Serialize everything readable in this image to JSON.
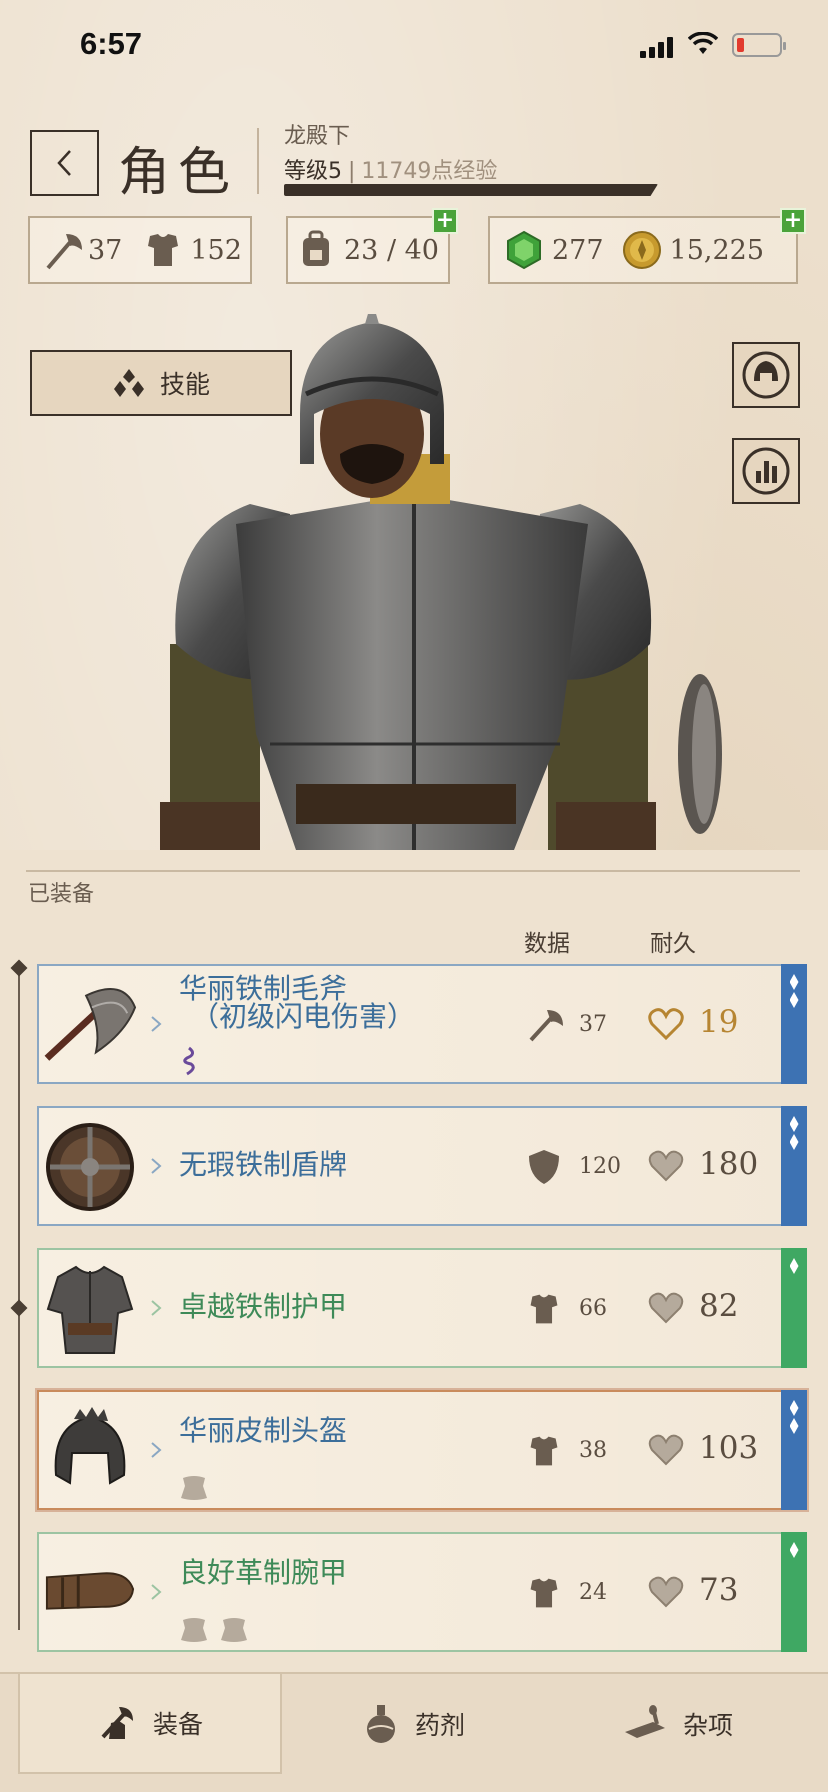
{
  "status_bar": {
    "time": "6:57"
  },
  "header": {
    "title": "角色",
    "player_name": "龙殿下",
    "level": "等级5",
    "separator": "|",
    "xp": "11749点经验"
  },
  "stats": {
    "attack": "37",
    "armor": "152",
    "carry": "23 / 40",
    "gems": "277",
    "gold": "15,225"
  },
  "character": {
    "skills_label": "技能"
  },
  "equipped": {
    "label": "已装备",
    "col_stats": "数据",
    "col_durability": "耐久",
    "items": [
      {
        "name": "华丽铁制毛斧",
        "name2": "（初级闪电伤害）",
        "stat": "37",
        "durability": "19",
        "rarity": "blue",
        "stat_icon": "axe-icon"
      },
      {
        "name": "无瑕铁制盾牌",
        "stat": "120",
        "durability": "180",
        "rarity": "blue",
        "stat_icon": "shield-icon"
      },
      {
        "name": "卓越铁制护甲",
        "stat": "66",
        "durability": "82",
        "rarity": "green",
        "stat_icon": "armor-icon"
      },
      {
        "name": "华丽皮制头盔",
        "stat": "38",
        "durability": "103",
        "rarity": "blue",
        "stat_icon": "armor-icon"
      },
      {
        "name": "良好革制腕甲",
        "stat": "24",
        "durability": "73",
        "rarity": "green",
        "stat_icon": "armor-icon"
      }
    ]
  },
  "bottom_nav": {
    "tabs": [
      {
        "label": "装备",
        "icon": "equipment-icon",
        "active": true
      },
      {
        "label": "药剂",
        "icon": "potion-icon",
        "active": false
      },
      {
        "label": "杂项",
        "icon": "misc-icon",
        "active": false
      }
    ]
  },
  "colors": {
    "rarity_blue": "#3d72b3",
    "rarity_green": "#3fa863",
    "plus_badge": "#4aa33a",
    "name_blue": "#3c6e9a",
    "name_green": "#3e8a58"
  }
}
